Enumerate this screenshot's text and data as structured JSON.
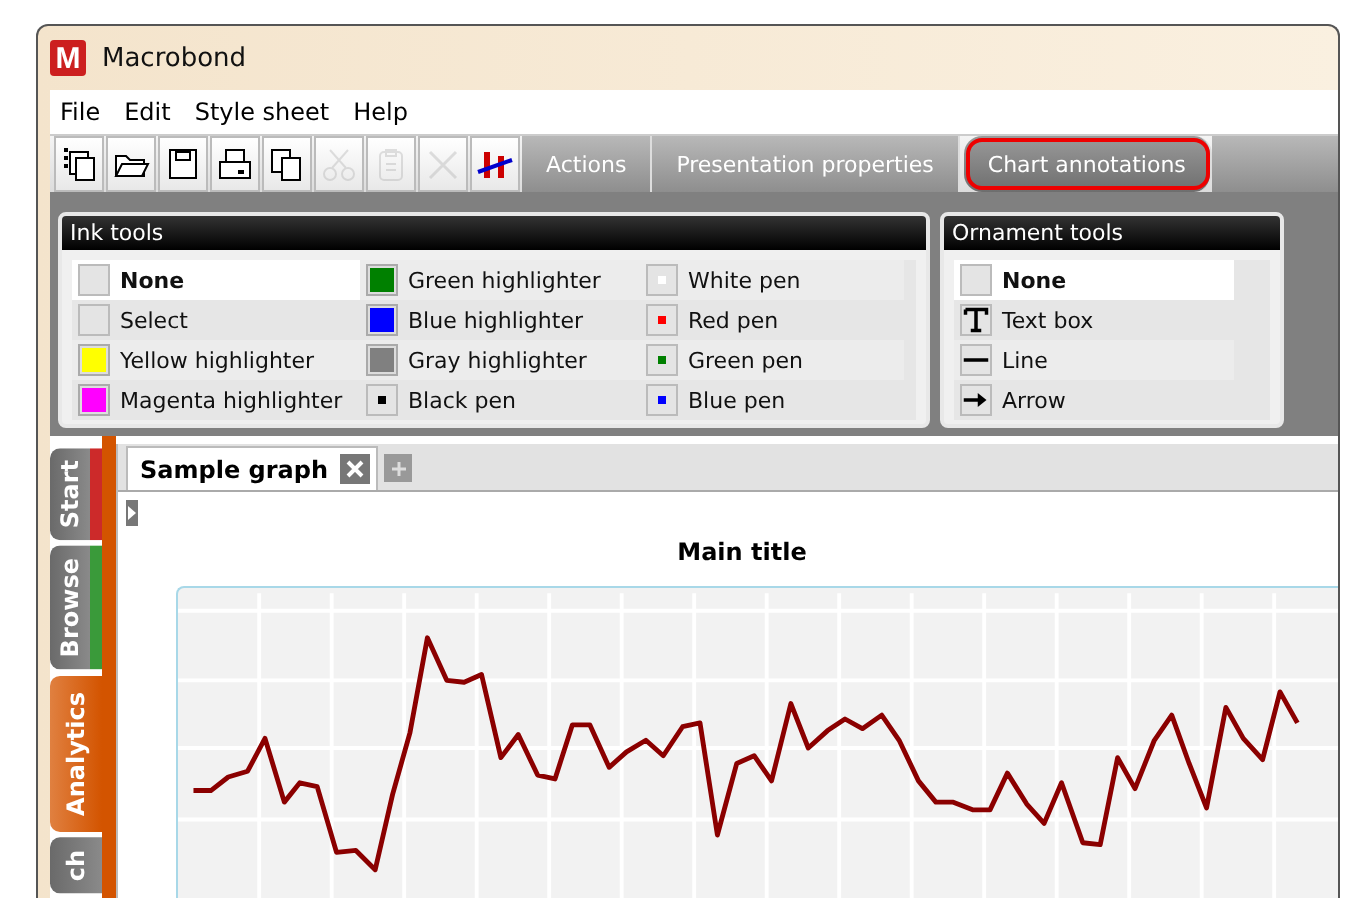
{
  "window": {
    "logo": "M",
    "title": "Macrobond"
  },
  "menu": [
    "File",
    "Edit",
    "Style sheet",
    "Help"
  ],
  "toolbar": [
    {
      "kind": "new",
      "disabled": false
    },
    {
      "kind": "open",
      "disabled": false
    },
    {
      "kind": "save",
      "disabled": false
    },
    {
      "kind": "print",
      "disabled": false
    },
    {
      "kind": "copy",
      "disabled": false
    },
    {
      "kind": "cut",
      "disabled": true
    },
    {
      "kind": "paste",
      "disabled": true
    },
    {
      "kind": "delete",
      "disabled": true
    },
    {
      "kind": "chart",
      "disabled": false
    }
  ],
  "ribbon_tabs": [
    {
      "label": "Actions",
      "selected": false
    },
    {
      "label": "Presentation properties",
      "selected": false
    },
    {
      "label": "Chart annotations",
      "selected": true
    }
  ],
  "ink_tools": {
    "title": "Ink tools",
    "items": [
      {
        "label": "None",
        "kind": "plain",
        "selected": true
      },
      {
        "label": "Select",
        "kind": "plain",
        "selected": false
      },
      {
        "label": "Yellow highlighter",
        "kind": "highlighter",
        "color": "#ffff00",
        "selected": false
      },
      {
        "label": "Magenta highlighter",
        "kind": "highlighter",
        "color": "#ff00ff",
        "selected": false
      },
      {
        "label": "Green highlighter",
        "kind": "highlighter",
        "color": "#008000",
        "selected": false
      },
      {
        "label": "Blue highlighter",
        "kind": "highlighter",
        "color": "#0000ff",
        "selected": false
      },
      {
        "label": "Gray highlighter",
        "kind": "highlighter",
        "color": "#808080",
        "selected": false
      },
      {
        "label": "Black pen",
        "kind": "pen",
        "color": "#000000",
        "selected": false
      },
      {
        "label": "White pen",
        "kind": "pen",
        "color": "#ffffff",
        "selected": false
      },
      {
        "label": "Red pen",
        "kind": "pen",
        "color": "#ff0000",
        "selected": false
      },
      {
        "label": "Green pen",
        "kind": "pen",
        "color": "#008000",
        "selected": false
      },
      {
        "label": "Blue pen",
        "kind": "pen",
        "color": "#0000ff",
        "selected": false
      }
    ]
  },
  "ornament_tools": {
    "title": "Ornament tools",
    "items": [
      {
        "label": "None",
        "kind": "plain",
        "selected": true
      },
      {
        "label": "Text box",
        "kind": "text",
        "selected": false
      },
      {
        "label": "Line",
        "kind": "line",
        "selected": false
      },
      {
        "label": "Arrow",
        "kind": "arrow",
        "selected": false
      }
    ]
  },
  "side_tabs": [
    {
      "label": "Start",
      "selected": false,
      "color": "#cc2a2a"
    },
    {
      "label": "Browse",
      "selected": false,
      "color": "#3a9a3a"
    },
    {
      "label": "Analytics",
      "selected": true
    },
    {
      "label": "ch",
      "selected": false
    }
  ],
  "doc_tabs": [
    {
      "label": "Sample graph",
      "selected": true
    }
  ],
  "chart": {
    "title": "Main title"
  }
}
